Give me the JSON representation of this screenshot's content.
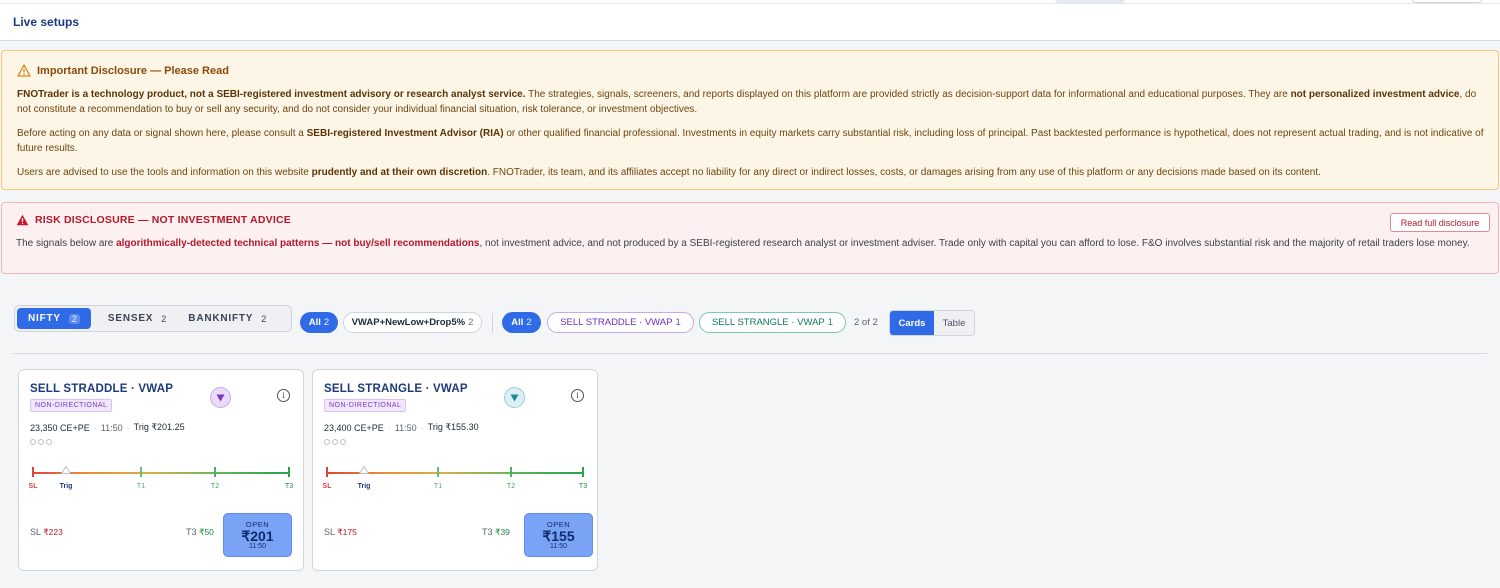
{
  "header": {
    "title": "Live setups"
  },
  "disclosure": {
    "title": "Important Disclosure — Please Read",
    "p1_bold1": "FNOTrader is a technology product, not a SEBI-registered investment advisory or research analyst service.",
    "p1_text1": " The strategies, signals, screeners, and reports displayed on this platform are provided strictly as decision-support data for informational and educational purposes. They are ",
    "p1_bold2": "not personalized investment advice",
    "p1_text2": ", do not constitute a recommendation to buy or sell any security, and do not consider your individual financial situation, risk tolerance, or investment objectives.",
    "p2_text1": "Before acting on any data or signal shown here, please consult a ",
    "p2_bold": "SEBI-registered Investment Advisor (RIA)",
    "p2_text2": " or other qualified financial professional. Investments in equity markets carry substantial risk, including loss of principal. Past backtested performance is hypothetical, does not represent actual trading, and is not indicative of future results.",
    "p3_text1": "Users are advised to use the tools and information on this website ",
    "p3_bold": "prudently and at their own discretion",
    "p3_text2": ". FNOTrader, its team, and its affiliates accept no liability for any direct or indirect losses, costs, or damages arising from any use of this platform or any decisions made based on its content."
  },
  "risk": {
    "title": "RISK DISCLOSURE — NOT INVESTMENT ADVICE",
    "button": "Read full disclosure",
    "text1": "The signals below are ",
    "bold": "algorithmically-detected technical patterns — not buy/sell recommendations",
    "text2": ", not investment advice, and not produced by a SEBI-registered research analyst or investment adviser. Trade only with capital you can afford to lose. F&O involves substantial risk and the majority of retail traders lose money."
  },
  "index_tabs": [
    {
      "label": "NIFTY",
      "count": "2"
    },
    {
      "label": "SENSEX",
      "count": "2"
    },
    {
      "label": "BANKNIFTY",
      "count": "2"
    }
  ],
  "filters": {
    "group1_all": {
      "label": "All",
      "count": "2"
    },
    "group1_item": {
      "label": "VWAP+NewLow+Drop5%",
      "count": "2"
    },
    "group2_all": {
      "label": "All",
      "count": "2"
    },
    "group2_items": [
      {
        "label": "SELL STRADDLE · VWAP",
        "count": "1"
      },
      {
        "label": "SELL STRANGLE · VWAP",
        "count": "1"
      }
    ],
    "result_count": "2 of 2",
    "view_cards": "Cards",
    "view_table": "Table"
  },
  "cards": [
    {
      "title": "SELL STRADDLE · VWAP",
      "tag": "NON-DIRECTIONAL",
      "strike": "23,350 CE+PE",
      "time": "11:50",
      "trig": "Trig ₹201.25",
      "labels": {
        "sl": "SL",
        "trig": "Trig",
        "t1": "T1",
        "t2": "T2",
        "t3": "T3"
      },
      "sl_label": "SL",
      "sl_value": "₹223",
      "t3_label": "T3",
      "t3_value": "₹50",
      "status": "OPEN",
      "price": "₹201",
      "status_time": "11:50"
    },
    {
      "title": "SELL STRANGLE · VWAP",
      "tag": "NON-DIRECTIONAL",
      "strike": "23,400 CE+PE",
      "time": "11:50",
      "trig": "Trig ₹155.30",
      "labels": {
        "sl": "SL",
        "trig": "Trig",
        "t1": "T1",
        "t2": "T2",
        "t3": "T3"
      },
      "sl_label": "SL",
      "sl_value": "₹175",
      "t3_label": "T3",
      "t3_value": "₹39",
      "status": "OPEN",
      "price": "₹155",
      "status_time": "11:50"
    }
  ]
}
